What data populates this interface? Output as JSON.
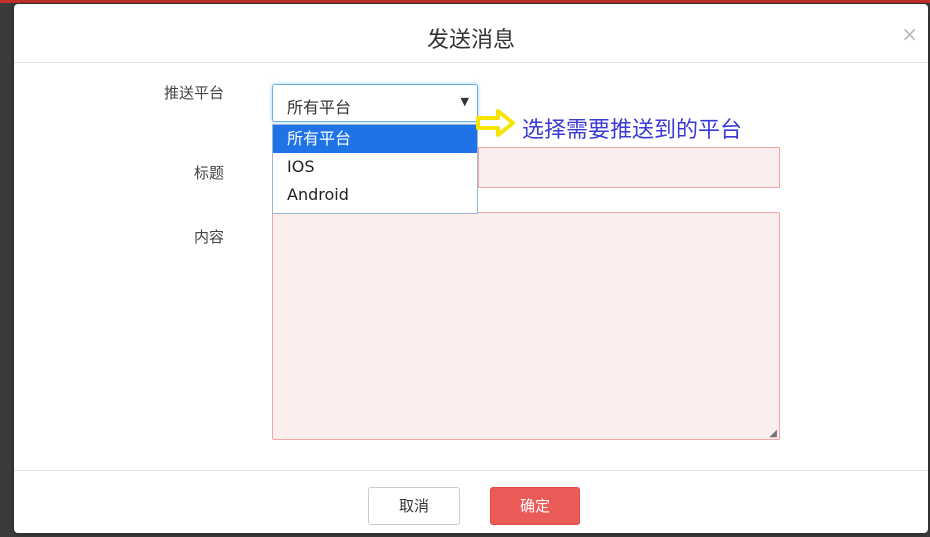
{
  "dialog": {
    "title": "发送消息",
    "close": "×"
  },
  "form": {
    "platform_label": "推送平台",
    "title_label": "标题",
    "content_label": "内容",
    "platform_value": "所有平台",
    "platform_options": [
      "所有平台",
      "IOS",
      "Android"
    ],
    "title_value": "",
    "content_value": ""
  },
  "footer": {
    "cancel_label": "取消",
    "confirm_label": "确定"
  },
  "annotation": {
    "text": "选择需要推送到的平台",
    "arrow_color": "#f5e400",
    "text_color": "#3a3ad6"
  },
  "colors": {
    "primary": "#ea5a57",
    "selected_option": "#1e73e6",
    "invalid_border": "#f2a6a6"
  }
}
